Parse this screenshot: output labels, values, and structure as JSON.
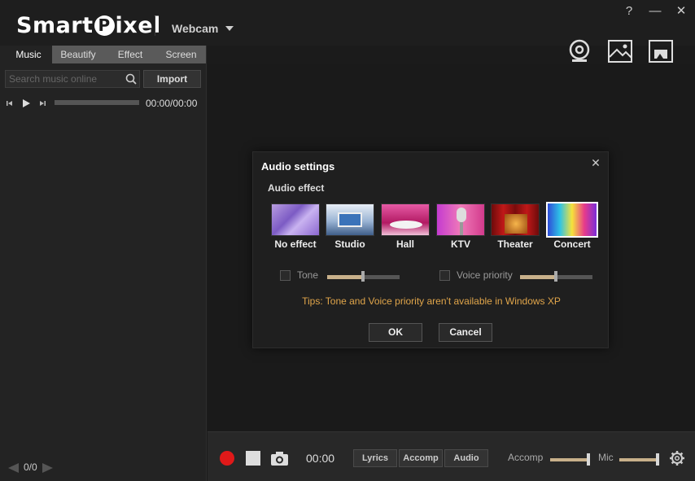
{
  "app": {
    "logo_pre": "Smart",
    "logo_mark": "P",
    "logo_post": "ixel",
    "source": "Webcam",
    "help": "?",
    "minimize": "—",
    "close": "✕"
  },
  "left": {
    "tabs": [
      "Music",
      "Beautify",
      "Effect",
      "Screen"
    ],
    "search_placeholder": "Search music online",
    "import": "Import",
    "time": "00:00/00:00",
    "pager": "0/0"
  },
  "dialog": {
    "title": "Audio settings",
    "section": "Audio effect",
    "effects": [
      "No effect",
      "Studio",
      "Hall",
      "KTV",
      "Theater",
      "Concert"
    ],
    "selected_effect": "Concert",
    "tone_label": "Tone",
    "tone_level": 0.5,
    "voice_label": "Voice priority",
    "voice_level": 0.5,
    "tips": "Tips: Tone and Voice priority aren't available in Windows XP",
    "ok": "OK",
    "cancel": "Cancel"
  },
  "bottom": {
    "time": "00:00",
    "buttons": [
      "Lyrics",
      "Accomp",
      "Audio"
    ],
    "accomp_label": "Accomp",
    "accomp_level": 1.0,
    "mic_label": "Mic",
    "mic_level": 1.0
  },
  "colors": {
    "accent_slider": "#c8b08a",
    "record": "#e01919",
    "tips": "#e0a54a"
  }
}
